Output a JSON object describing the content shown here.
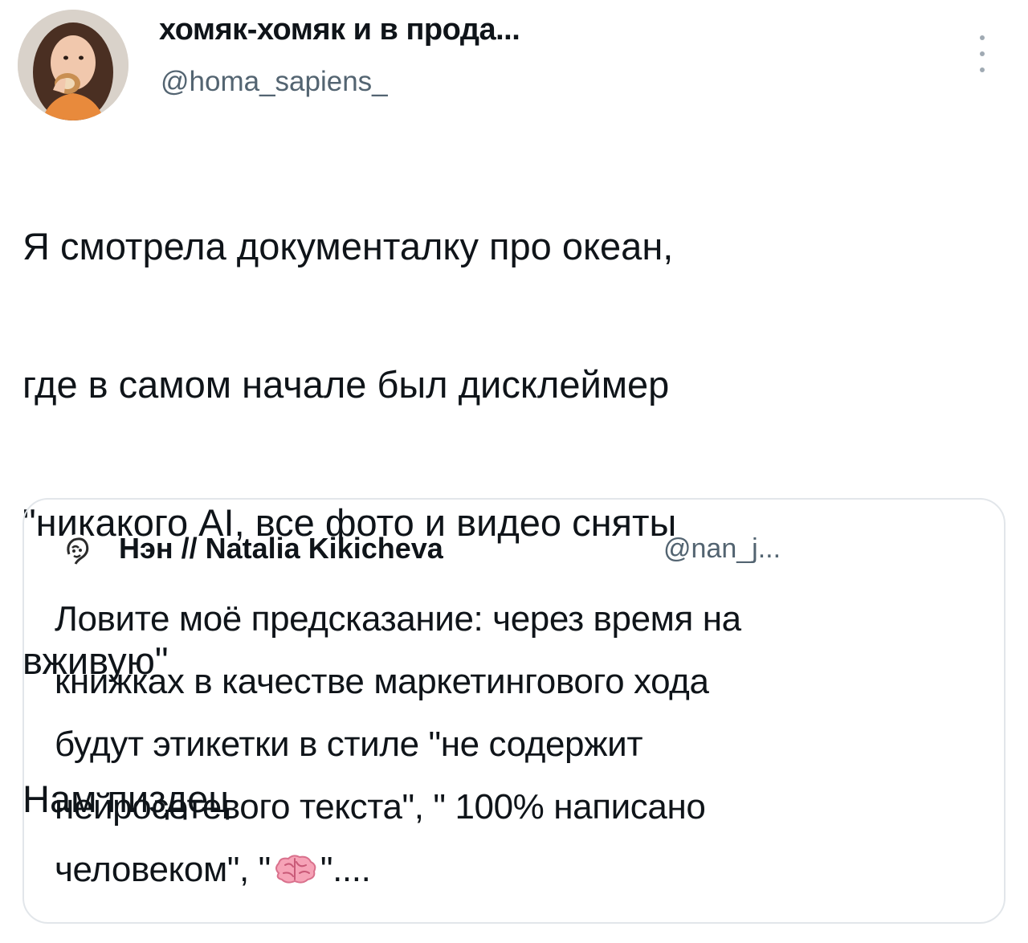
{
  "tweet": {
    "author_name": "хомяк-хомяк и в прода...",
    "author_handle": "@homa_sapiens_",
    "text_lines": [
      "Я смотрела документалку про океан,",
      "где в самом начале был дисклеймер",
      "\"никакого AI, все фото и видео сняты",
      "вживую\"",
      "Нам пиздец"
    ]
  },
  "quote": {
    "author_name": "Нэн // Natalia Kikicheva",
    "author_handle": "@nan_j...",
    "lines": [
      "Ловите моё предсказание: через время на",
      "книжках в качестве маркетингового хода",
      "будут этикетки в стиле \"не содержит",
      "нейросетевого текста\", \" 100% написано"
    ],
    "last_line_before_icon": "человеком\", \"",
    "last_line_after_icon": "\"....",
    "inline_icon": "brain-emoji"
  },
  "icons": {
    "more": "vertical-dots-icon",
    "author_avatar": "avatar-photo",
    "quote_avatar": "sketch-avatar"
  },
  "colors": {
    "text": "#0f1419",
    "secondary_text": "#536471",
    "card_border": "#e2e6ea",
    "dots": "#a0aab3"
  }
}
